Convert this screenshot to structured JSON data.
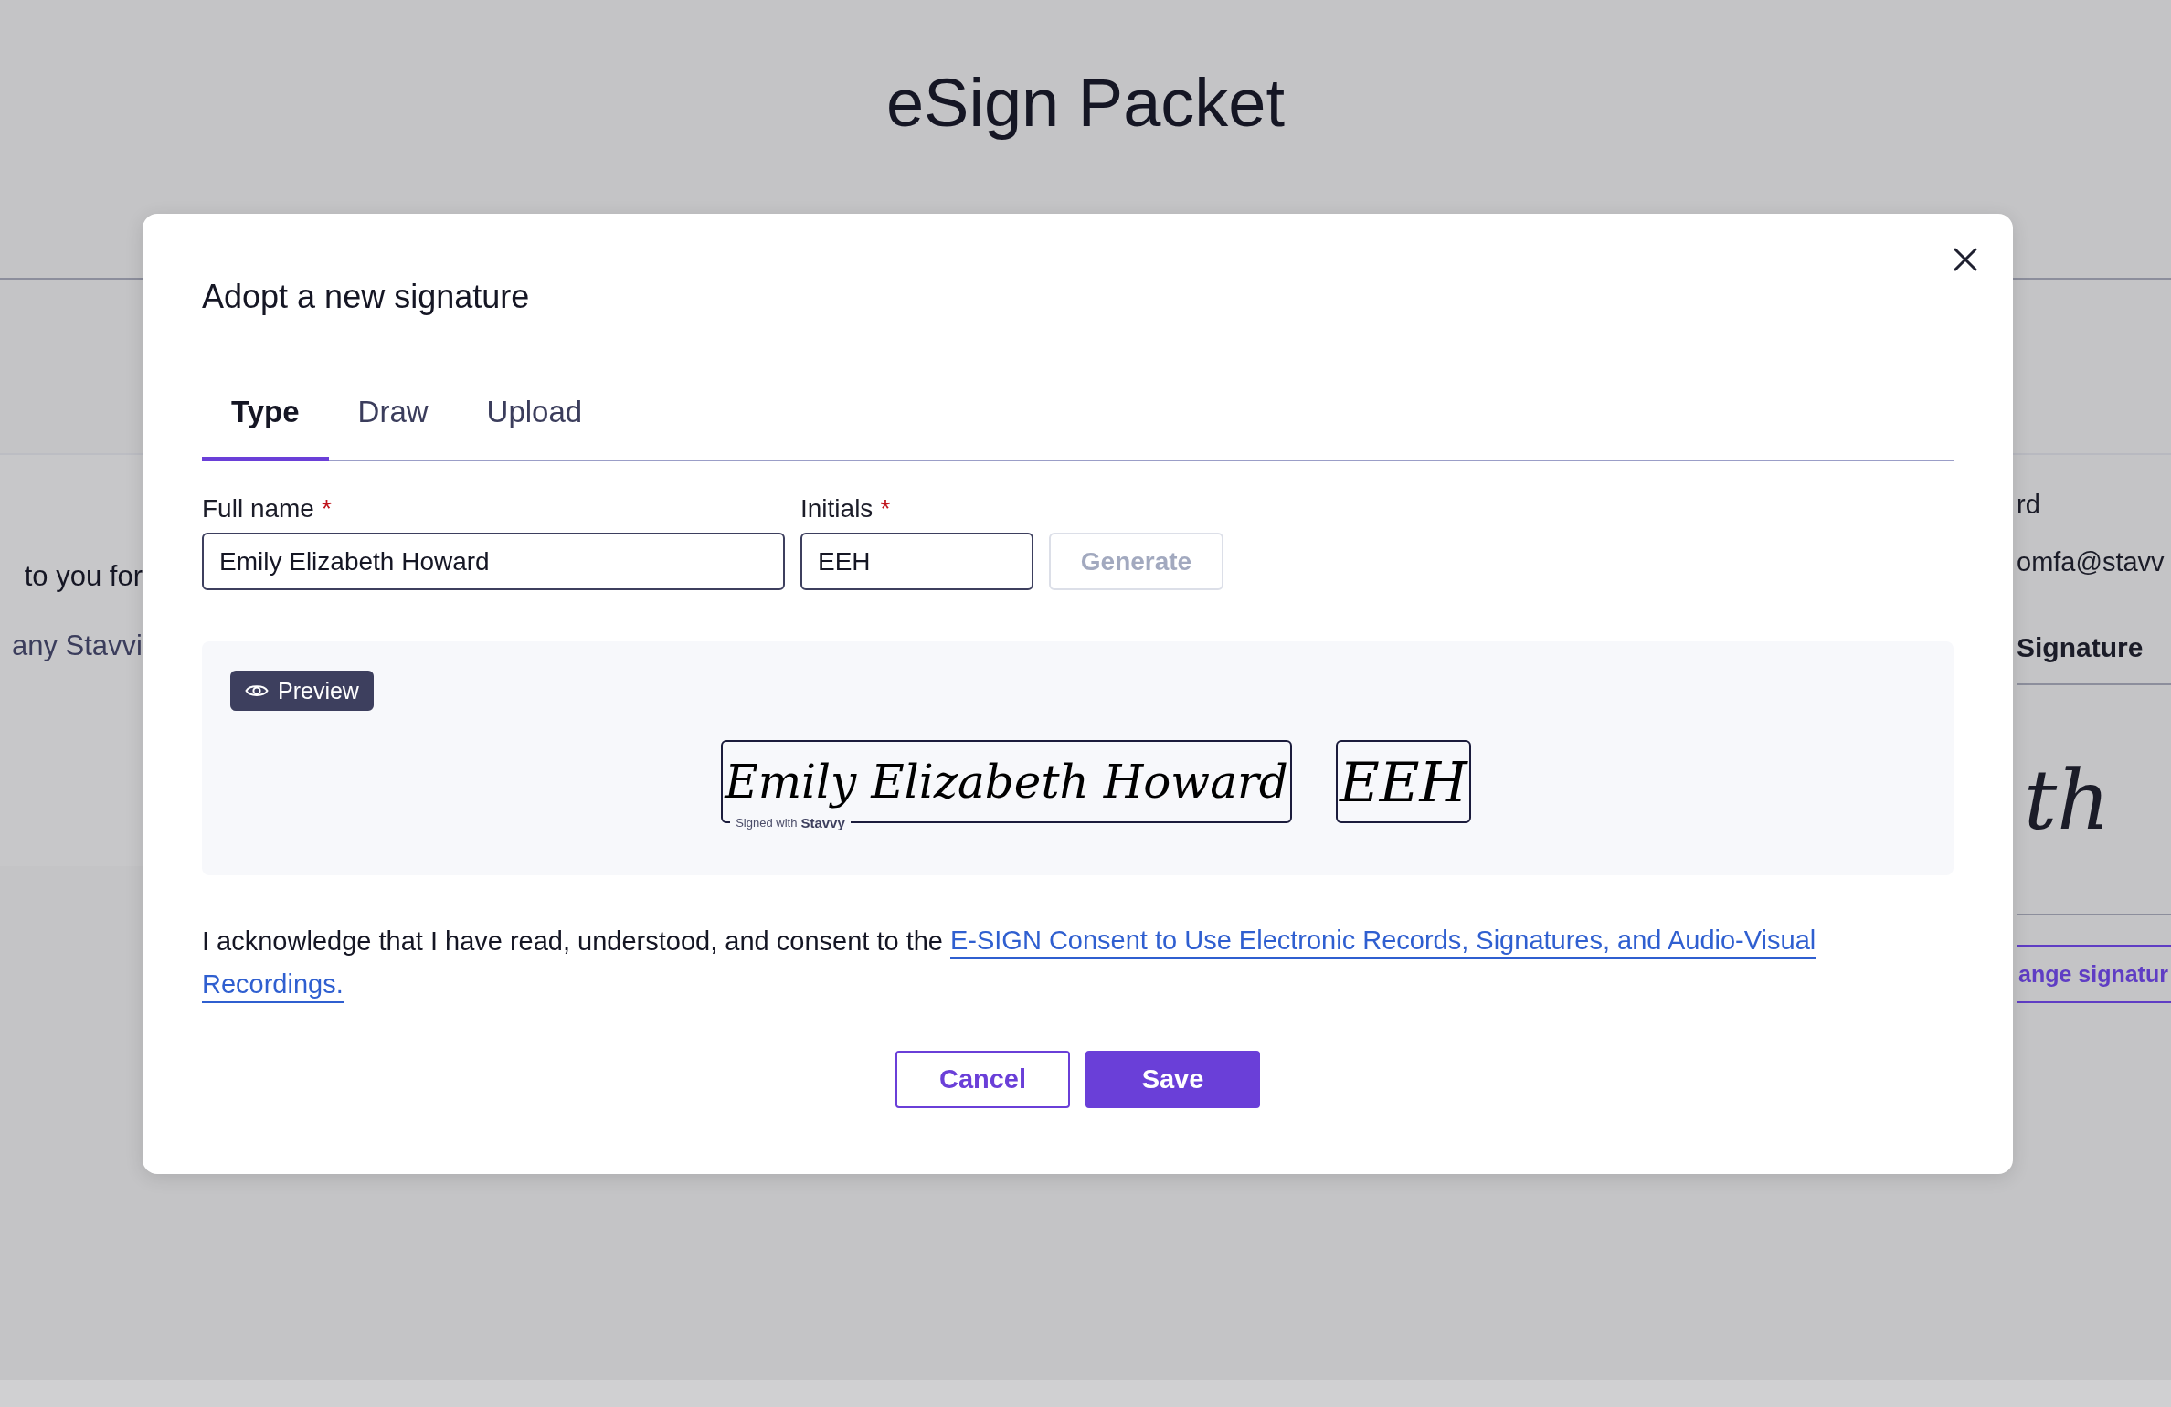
{
  "page": {
    "title": "eSign Packet"
  },
  "background": {
    "left_texts": [
      "to you for",
      "any Stavvi"
    ],
    "right_texts": [
      "rd",
      "omfa@stavv"
    ],
    "signature_heading": "Signature",
    "signature": "th",
    "change_button": "ange signatur"
  },
  "dialog": {
    "title": "Adopt a new signature",
    "tabs": [
      {
        "label": "Type",
        "selected": true
      },
      {
        "label": "Draw",
        "selected": false
      },
      {
        "label": "Upload",
        "selected": false
      }
    ],
    "fields": [
      {
        "label": "Full name",
        "required_mark": "*",
        "value": "Emily Elizabeth Howard",
        "kind": "wide"
      },
      {
        "label": "Initials",
        "required_mark": "*",
        "value": "EEH",
        "kind": "narrow"
      }
    ],
    "generate": {
      "label": "Generate",
      "disabled": true
    },
    "preview": {
      "badge": "Preview",
      "signature": "Emily Elizabeth Howard",
      "initials": "EEH",
      "footer_prefix": "Signed with",
      "footer_brand": "Stavvy"
    },
    "consent": {
      "text": "I acknowledge that I have read, understood, and consent to the",
      "link_lines": [
        "E-SIGN Consent to Use Electronic Records, Signatures, and Audio-Visual",
        "Recordings."
      ]
    },
    "buttons": [
      {
        "label": "Cancel",
        "kind": "secondary"
      },
      {
        "label": "Save",
        "kind": "primary"
      }
    ]
  }
}
